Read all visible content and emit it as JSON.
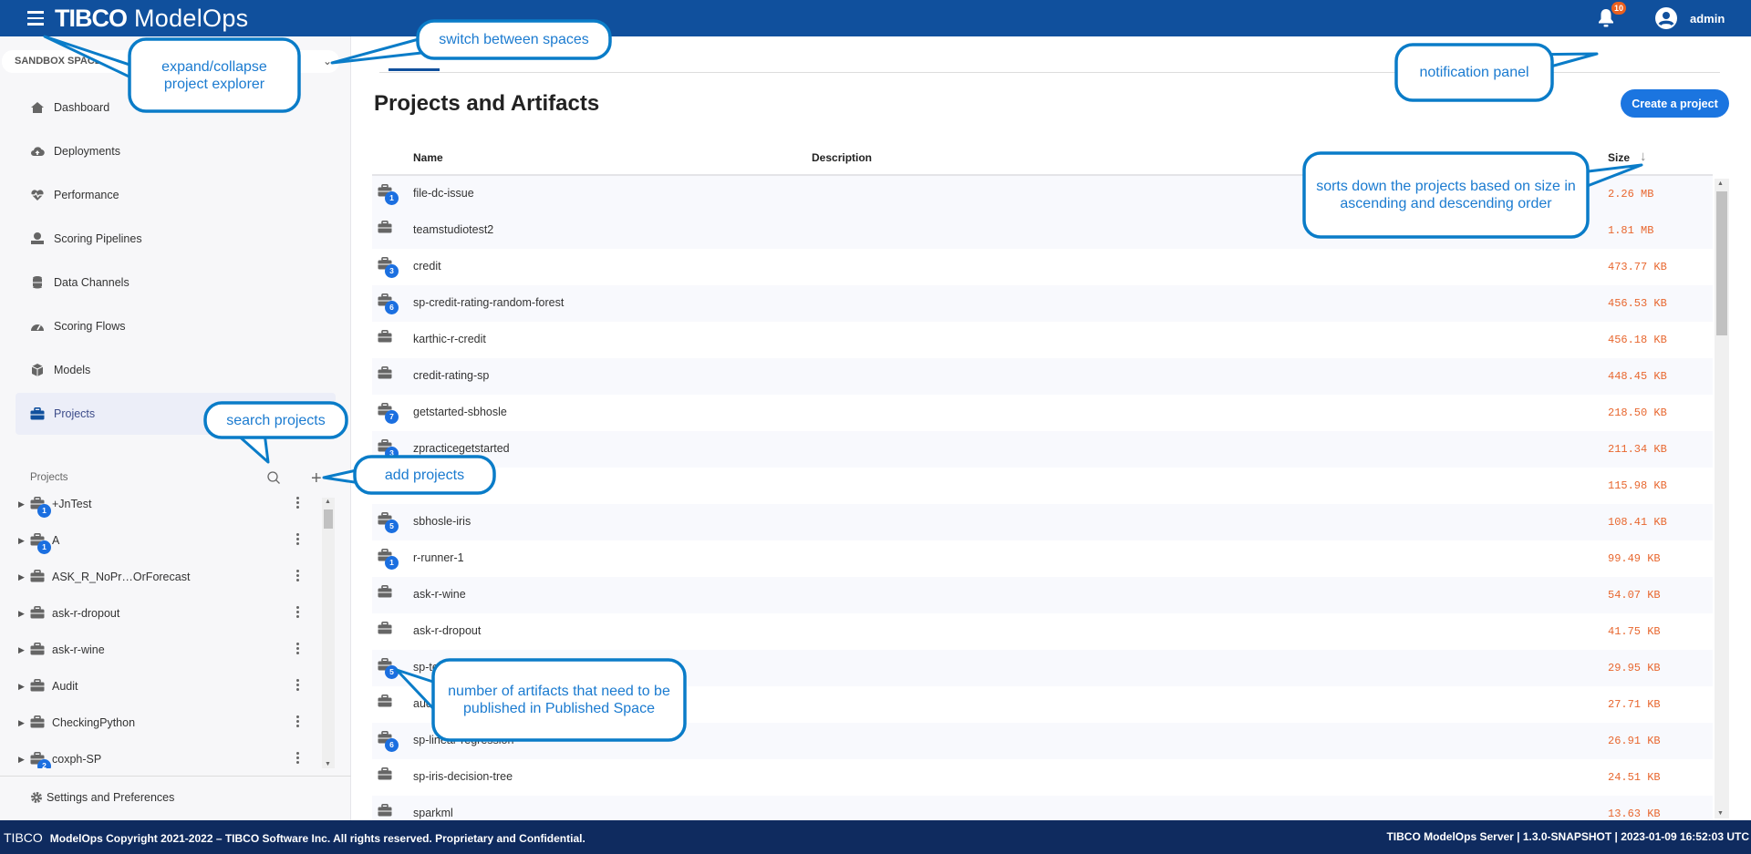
{
  "header": {
    "brand": "TIBCO",
    "product": "ModelOps",
    "notification_count": "10",
    "user": "admin"
  },
  "sidebar": {
    "space": "SANDBOX SPACE",
    "nav": [
      {
        "label": "Dashboard",
        "icon": "home-icon"
      },
      {
        "label": "Deployments",
        "icon": "cloud-upload-icon"
      },
      {
        "label": "Performance",
        "icon": "heart-pulse-icon"
      },
      {
        "label": "Scoring Pipelines",
        "icon": "pipeline-icon"
      },
      {
        "label": "Data Channels",
        "icon": "database-icon"
      },
      {
        "label": "Scoring Flows",
        "icon": "gauge-icon"
      },
      {
        "label": "Models",
        "icon": "cube-icon"
      },
      {
        "label": "Projects",
        "icon": "briefcase-icon",
        "active": true
      }
    ],
    "projects_title": "Projects",
    "tree": [
      {
        "name": "+JnTest",
        "badge": "1"
      },
      {
        "name": "A",
        "badge": "1"
      },
      {
        "name": "ASK_R_NoPr…OrForecast",
        "badge": ""
      },
      {
        "name": "ask-r-dropout",
        "badge": ""
      },
      {
        "name": "ask-r-wine",
        "badge": ""
      },
      {
        "name": "Audit",
        "badge": ""
      },
      {
        "name": "CheckingPython",
        "badge": ""
      },
      {
        "name": "coxph-SP",
        "badge": "2"
      }
    ],
    "settings": "Settings and Preferences"
  },
  "main": {
    "title": "Projects and Artifacts",
    "create_button": "Create a project",
    "columns": {
      "name": "Name",
      "description": "Description",
      "size": "Size"
    },
    "rows": [
      {
        "name": "file-dc-issue",
        "badge": "1",
        "size": "2.26 MB"
      },
      {
        "name": "teamstudiotest2",
        "badge": "",
        "size": "1.81 MB"
      },
      {
        "name": "credit",
        "badge": "3",
        "size": "473.77 KB"
      },
      {
        "name": "sp-credit-rating-random-forest",
        "badge": "6",
        "size": "456.53 KB"
      },
      {
        "name": "karthic-r-credit",
        "badge": "",
        "size": "456.18 KB"
      },
      {
        "name": "credit-rating-sp",
        "badge": "",
        "size": "448.45 KB"
      },
      {
        "name": "getstarted-sbhosle",
        "badge": "7",
        "size": "218.50 KB"
      },
      {
        "name": "zpracticegetstarted",
        "badge": "3",
        "size": "211.34 KB"
      },
      {
        "name": "test-sbhosle",
        "badge": "",
        "size": "115.98 KB"
      },
      {
        "name": "sbhosle-iris",
        "badge": "5",
        "size": "108.41 KB"
      },
      {
        "name": "r-runner-1",
        "badge": "1",
        "size": "99.49 KB"
      },
      {
        "name": "ask-r-wine",
        "badge": "",
        "size": "54.07 KB"
      },
      {
        "name": "ask-r-dropout",
        "badge": "",
        "size": "41.75 KB"
      },
      {
        "name": "sp-test",
        "badge": "5",
        "size": "29.95 KB"
      },
      {
        "name": "audit",
        "badge": "",
        "size": "27.71 KB"
      },
      {
        "name": "sp-linear-regression",
        "badge": "6",
        "size": "26.91 KB"
      },
      {
        "name": "sp-iris-decision-tree",
        "badge": "",
        "size": "24.51 KB"
      },
      {
        "name": "sparkml",
        "badge": "",
        "size": "13.63 KB"
      }
    ]
  },
  "footer": {
    "logo": "TIBCO",
    "copyright": "ModelOps Copyright 2021-2022 – TIBCO Software Inc. All rights reserved. Proprietary and Confidential.",
    "server": "TIBCO ModelOps Server | 1.3.0-SNAPSHOT | 2023-01-09 16:52:03 UTC"
  },
  "callouts": {
    "expand": "expand/collapse project explorer",
    "spaces": "switch between spaces",
    "notification": "notification panel",
    "sort": "sorts down the projects based on size in ascending and descending order",
    "search": "search projects",
    "add": "add projects",
    "artifacts": "number of artifacts that need to be published in Published Space"
  },
  "colors": {
    "header": "#10509d",
    "footer": "#0f2b5f",
    "accent": "#1b75e0",
    "size_text": "#e8672f",
    "callout": "#1b7bd0"
  }
}
